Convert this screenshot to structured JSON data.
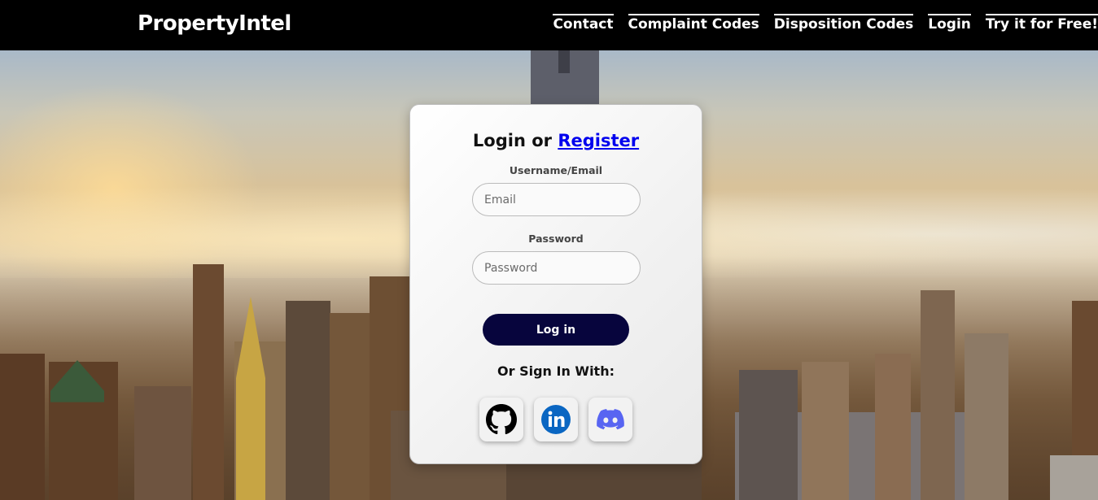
{
  "header": {
    "brand": "PropertyIntel",
    "nav": [
      {
        "label": "Contact"
      },
      {
        "label": "Complaint Codes"
      },
      {
        "label": "Disposition Codes"
      },
      {
        "label": "Login"
      },
      {
        "label": "Try it for Free!"
      }
    ]
  },
  "login_card": {
    "title_prefix": "Login or ",
    "register_link": "Register",
    "username_label": "Username/Email",
    "email_placeholder": "Email",
    "password_label": "Password",
    "password_placeholder": "Password",
    "login_button": "Log in",
    "sign_in_with": "Or Sign In With:",
    "social": [
      {
        "name": "github-icon",
        "color": "#000000"
      },
      {
        "name": "linkedin-icon",
        "color": "#0a66c2"
      },
      {
        "name": "discord-icon",
        "color": "#5865f2"
      }
    ]
  },
  "colors": {
    "topbar": "#000000",
    "login_button": "#07053d",
    "link": "#0000ee"
  }
}
